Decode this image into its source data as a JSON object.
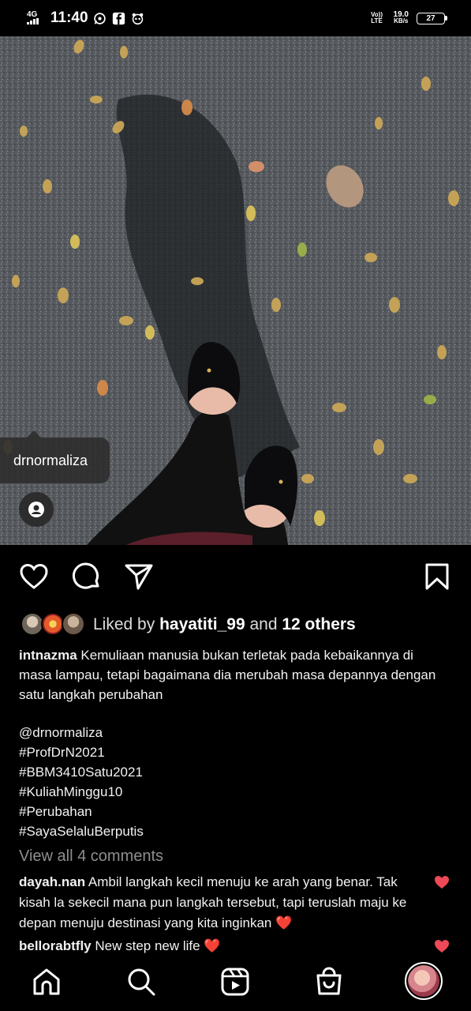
{
  "status_bar": {
    "network": "4G",
    "time": "11:40",
    "volte": "Vo)) LTE",
    "speed_value": "19.0",
    "speed_unit": "KB/s",
    "battery": "27"
  },
  "post": {
    "tagged_user": "drnormaliza",
    "liked_by_prefix": "Liked by",
    "liked_by_user": "hayatiti_99",
    "liked_by_and": "and",
    "liked_by_others": "12 others",
    "caption_user": "intnazma",
    "caption_text": "Kemuliaan manusia bukan terletak pada kebaikannya di masa lampau, tetapi bagaimana dia merubah masa depannya dengan satu langkah perubahan",
    "hashtags": [
      "@drnormaliza",
      "#ProfDrN2021",
      "#BBM3410Satu2021",
      "#KuliahMinggu10",
      "#Perubahan",
      "#SayaSelaluBerputis"
    ],
    "view_all_comments": "View all 4 comments"
  },
  "comments": [
    {
      "user": "dayah.nan",
      "text": "Ambil langkah kecil menuju ke arah yang benar. Tak kisah la sekecil mana pun langkah tersebut, tapi teruslah maju ke depan menuju destinasi yang kita inginkan",
      "emoji": "❤️"
    },
    {
      "user": "bellorabtfly",
      "text": "New step new life",
      "emoji": "❤️"
    }
  ],
  "colors": {
    "like_red": "#ed4956",
    "background": "#000000",
    "muted": "#8e8e8e"
  },
  "icons": {
    "actions": [
      "heart-icon",
      "comment-icon",
      "share-icon",
      "bookmark-icon"
    ],
    "nav": [
      "home-icon",
      "search-icon",
      "reels-icon",
      "shop-icon",
      "profile-avatar"
    ]
  }
}
